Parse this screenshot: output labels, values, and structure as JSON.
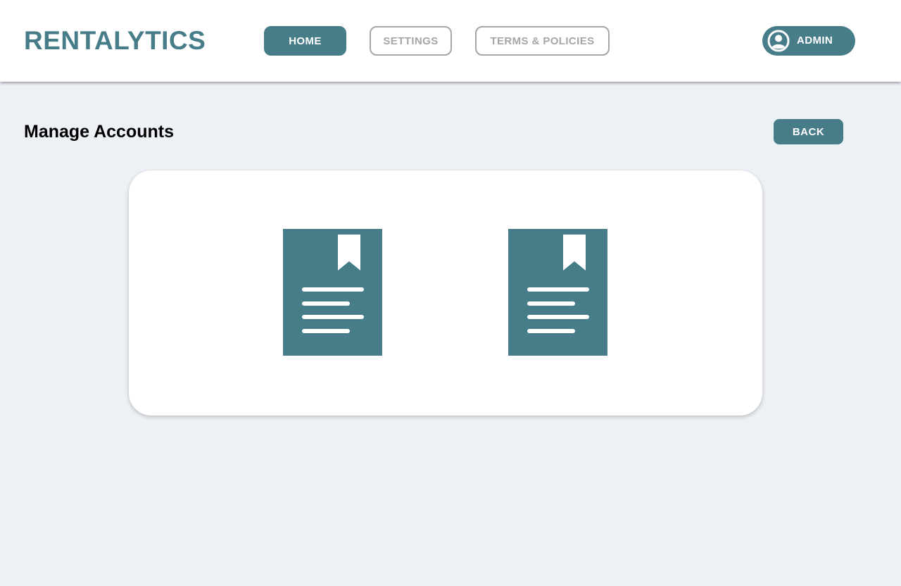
{
  "app": {
    "brand": "RENTALYTICS"
  },
  "nav": {
    "items": [
      {
        "label": "HOME",
        "active": true
      },
      {
        "label": "SETTINGS",
        "active": false
      },
      {
        "label": "TERMS & POLICIES",
        "active": false
      }
    ]
  },
  "user": {
    "label": "ADMIN",
    "icon": "user-circle-icon"
  },
  "page": {
    "title": "Manage Accounts",
    "back_label": "BACK"
  },
  "documents": [
    {
      "icon": "bookmarked-document-icon"
    },
    {
      "icon": "bookmarked-document-icon"
    }
  ],
  "colors": {
    "accent": "#477d89",
    "background": "#edf0f5",
    "inactive": "#a7a5a5"
  }
}
